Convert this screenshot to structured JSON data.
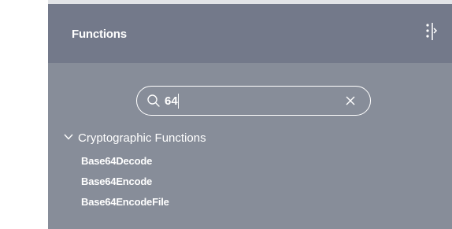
{
  "panel": {
    "title": "Functions"
  },
  "search": {
    "value": "64",
    "placeholder": ""
  },
  "category": {
    "label": "Cryptographic Functions",
    "expanded": true,
    "items": [
      "Base64Decode",
      "Base64Encode",
      "Base64EncodeFile"
    ]
  },
  "icons": {
    "collapse": "panel-collapse-icon",
    "search": "search-icon",
    "clear": "close-icon",
    "expand": "chevron-down-icon"
  },
  "colors": {
    "panel_bg": "#878d99",
    "header_bg": "#73798a",
    "text": "#ffffff"
  }
}
